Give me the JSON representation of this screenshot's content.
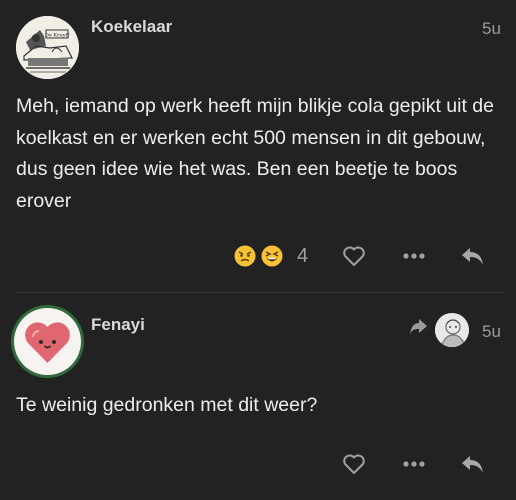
{
  "posts": [
    {
      "username": "Koekelaar",
      "age": "5u",
      "avatar_icon": "sketch-logo-avatar",
      "avatar_text": "De Kruyff",
      "text": "Meh, iemand op werk heeft mijn blikje cola gepikt uit de koelkast en er werken echt 500 mensen in dit gebouw, dus geen idee wie het was. Ben een beetje te boos erover",
      "reactions": {
        "emojis": [
          "angry-face",
          "laughing-face"
        ],
        "count": "4"
      },
      "actions": [
        "like-icon",
        "more-icon",
        "reply-icon"
      ]
    },
    {
      "username": "Fenayi",
      "age": "5u",
      "avatar_icon": "heart-face-avatar",
      "reply_to_icon": "reply-arrow-icon",
      "text": "Te weinig gedronken met dit weer?",
      "actions": [
        "like-icon",
        "more-icon",
        "reply-icon"
      ]
    }
  ],
  "colors": {
    "background": "#222222",
    "text": "#ededed",
    "muted": "#9a9a9a",
    "heart": "#e0666f",
    "avatar_ring": "#2f6b3a"
  }
}
